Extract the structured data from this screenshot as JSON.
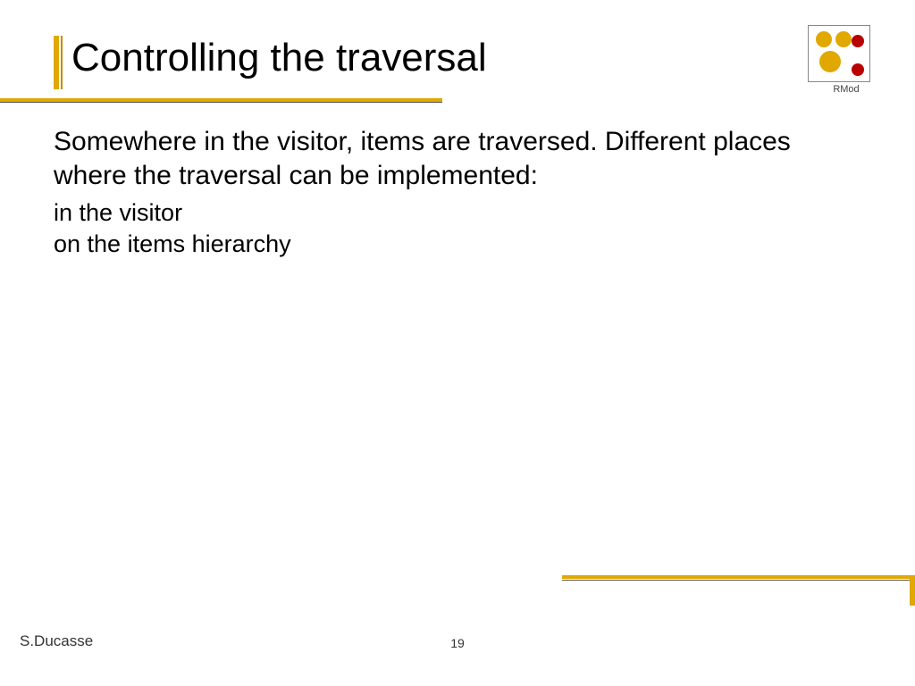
{
  "title": "Controlling the traversal",
  "logo_label": "RMod",
  "content": {
    "paragraph": "Somewhere in the visitor, items are traversed. Different places where the traversal can be implemented:",
    "items": [
      "in the visitor",
      "on the items hierarchy"
    ]
  },
  "footer": {
    "author": "S.Ducasse",
    "page": "19"
  }
}
